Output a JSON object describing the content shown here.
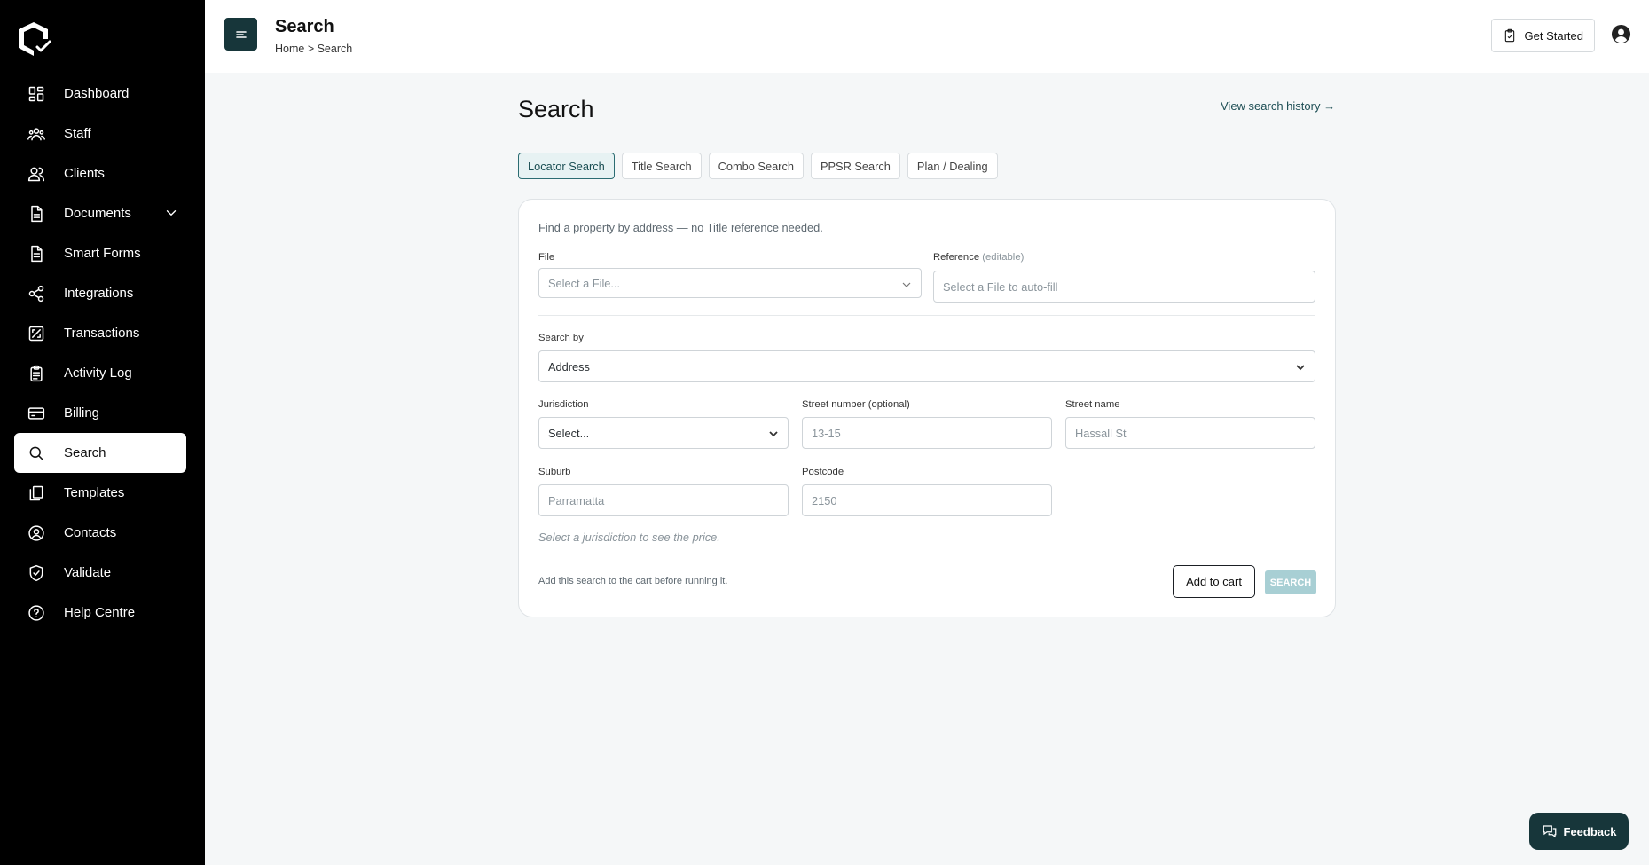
{
  "sidebar": {
    "items": [
      {
        "label": "Dashboard",
        "icon": "dashboard-icon"
      },
      {
        "label": "Staff",
        "icon": "staff-icon"
      },
      {
        "label": "Clients",
        "icon": "clients-icon"
      },
      {
        "label": "Documents",
        "icon": "documents-icon"
      },
      {
        "label": "Smart Forms",
        "icon": "smart-forms-icon"
      },
      {
        "label": "Integrations",
        "icon": "integrations-icon"
      },
      {
        "label": "Transactions",
        "icon": "transactions-icon"
      },
      {
        "label": "Activity Log",
        "icon": "activity-log-icon"
      },
      {
        "label": "Billing",
        "icon": "billing-icon"
      },
      {
        "label": "Search",
        "icon": "search-icon"
      },
      {
        "label": "Templates",
        "icon": "templates-icon"
      },
      {
        "label": "Contacts",
        "icon": "contacts-icon"
      },
      {
        "label": "Validate",
        "icon": "validate-icon"
      },
      {
        "label": "Help Centre",
        "icon": "help-icon"
      }
    ],
    "active": "Search"
  },
  "header": {
    "title": "Search",
    "breadcrumb": "Home > Search",
    "get_started": "Get Started"
  },
  "main": {
    "title": "Search",
    "history_link": "View search history →",
    "tabs": [
      "Locator Search",
      "Title Search",
      "Combo Search",
      "PPSR Search",
      "Plan / Dealing"
    ],
    "active_tab": "Locator Search",
    "form": {
      "hint": "Find a property by address — no Title reference needed.",
      "file_label": "File",
      "file_placeholder": "Select a File...",
      "reference_label": "Reference",
      "reference_note": "(editable)",
      "reference_placeholder": "Select a File to auto-fill",
      "search_by_label": "Search by",
      "search_by_value": "Address",
      "jurisdiction_label": "Jurisdiction",
      "jurisdiction_value": "Select...",
      "street_number_label": "Street number (optional)",
      "street_number_placeholder": "13-15",
      "street_name_label": "Street name",
      "street_name_placeholder": "Hassall St",
      "suburb_label": "Suburb",
      "suburb_placeholder": "Parramatta",
      "postcode_label": "Postcode",
      "postcode_placeholder": "2150",
      "price_hint": "Select a jurisdiction to see the price.",
      "cart_hint": "Add this search to the cart before running it.",
      "add_to_cart": "Add to cart",
      "search_button": "SEARCH"
    }
  },
  "feedback": "Feedback",
  "colors": {
    "sidebar_bg": "#000000",
    "accent": "#17363a",
    "active_tab_bg": "#e7f2f3",
    "search_disabled": "#a8cfd4"
  }
}
